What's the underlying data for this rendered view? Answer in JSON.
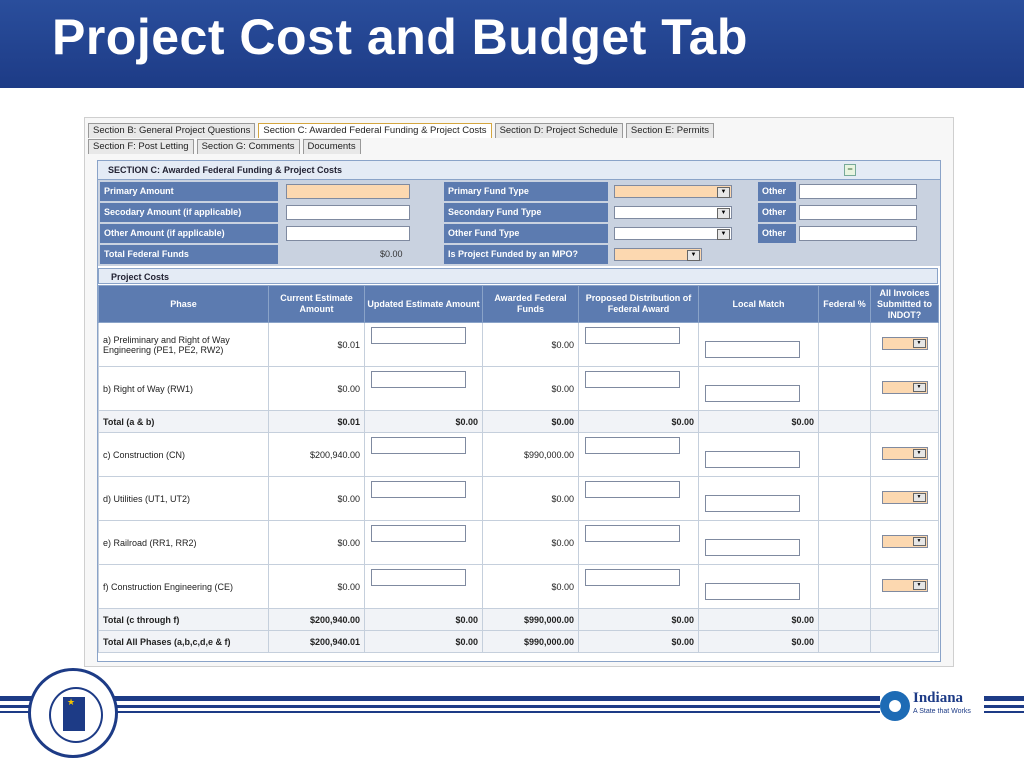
{
  "slide": {
    "title": "Project Cost and Budget Tab"
  },
  "tabs_row1": [
    "Section B: General Project Questions",
    "Section C: Awarded Federal Funding & Project Costs",
    "Section D: Project Schedule",
    "Section E: Permits"
  ],
  "tabs_row2": [
    "Section F: Post Letting",
    "Section G: Comments",
    "Documents"
  ],
  "section_c": {
    "header": "SECTION C: Awarded Federal Funding & Project Costs",
    "collapse_symbol": "−",
    "fields": {
      "primary_amount_label": "Primary Amount",
      "secondary_amount_label": "Secodary Amount (if applicable)",
      "other_amount_label": "Other Amount (if applicable)",
      "total_federal_label": "Total Federal Funds",
      "total_federal_value": "$0.00",
      "primary_fund_type_label": "Primary Fund Type",
      "secondary_fund_type_label": "Secondary Fund Type",
      "other_fund_type_label": "Other Fund Type",
      "mpo_label": "Is Project Funded by an MPO?",
      "other_label": "Other"
    }
  },
  "project_costs": {
    "header": "Project Costs",
    "columns": [
      "Phase",
      "Current Estimate Amount",
      "Updated Estimate Amount",
      "Awarded Federal Funds",
      "Proposed Distribution of Federal Award",
      "Local Match",
      "Federal %",
      "All Invoices Submitted to INDOT?"
    ],
    "rows": [
      {
        "phase": "a) Preliminary and Right of Way Engineering (PE1, PE2, RW2)",
        "current": "$0.01",
        "awarded": "$0.00"
      },
      {
        "phase": "b) Right of Way (RW1)",
        "current": "$0.00",
        "awarded": "$0.00"
      },
      {
        "phase": "Total (a & b)",
        "current": "$0.01",
        "updated": "$0.00",
        "awarded": "$0.00",
        "proposed": "$0.00",
        "local": "$0.00",
        "total": true
      },
      {
        "phase": "c) Construction (CN)",
        "current": "$200,940.00",
        "awarded": "$990,000.00"
      },
      {
        "phase": "d) Utilities (UT1, UT2)",
        "current": "$0.00",
        "awarded": "$0.00"
      },
      {
        "phase": "e) Railroad (RR1, RR2)",
        "current": "$0.00",
        "awarded": "$0.00"
      },
      {
        "phase": "f) Construction Engineering (CE)",
        "current": "$0.00",
        "awarded": "$0.00"
      },
      {
        "phase": "Total (c through f)",
        "current": "$200,940.00",
        "updated": "$0.00",
        "awarded": "$990,000.00",
        "proposed": "$0.00",
        "local": "$0.00",
        "total": true
      },
      {
        "phase": "Total All Phases (a,b,c,d,e & f)",
        "current": "$200,940.01",
        "updated": "$0.00",
        "awarded": "$990,000.00",
        "proposed": "$0.00",
        "local": "$0.00",
        "total": true
      }
    ]
  },
  "logos": {
    "indot_seal": "INDOT seal",
    "indiana_name": "Indiana",
    "indiana_tagline": "A State that Works"
  },
  "colors": {
    "title_bar": "#1d3b86",
    "label_blue": "#5c7bb0",
    "required_field": "#fcd8b0"
  }
}
